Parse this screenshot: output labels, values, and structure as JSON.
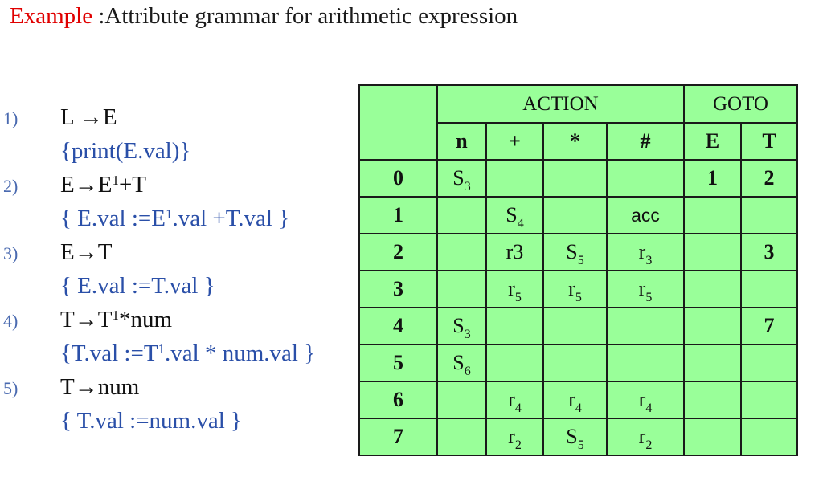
{
  "title": {
    "keyword": "Example",
    "text": " :Attribute grammar for arithmetic expression"
  },
  "rules": [
    {
      "num": "1)",
      "prod_a": "L →E",
      "prod_sup": "",
      "prod_b": "",
      "action_a": "{print(E.val)}",
      "action_sup": "",
      "action_b": ""
    },
    {
      "num": "2)",
      "prod_a": "E→E",
      "prod_sup": "1",
      "prod_b": "+T",
      "action_a": "{ E.val :=E",
      "action_sup": "1",
      "action_b": ".val +T.val }"
    },
    {
      "num": "3)",
      "prod_a": "E→T",
      "prod_sup": "",
      "prod_b": "",
      "action_a": "{ E.val :=T.val }",
      "action_sup": "",
      "action_b": ""
    },
    {
      "num": "4)",
      "prod_a": "T→T",
      "prod_sup": "1",
      "prod_b": "*num",
      "action_a": "{T.val :=T",
      "action_sup": "1",
      "action_b": ".val * num.val }"
    },
    {
      "num": "5)",
      "prod_a": "T→num",
      "prod_sup": "",
      "prod_b": "",
      "action_a": "{  T.val :=num.val }",
      "action_sup": "",
      "action_b": ""
    }
  ],
  "table": {
    "group_action": "ACTION",
    "group_goto": "GOTO",
    "columns": [
      "n",
      "+",
      "*",
      "#",
      "E",
      "T"
    ],
    "rows": [
      {
        "state": "0",
        "cells": [
          [
            "S",
            "3"
          ],
          [
            "",
            ""
          ],
          [
            "",
            ""
          ],
          [
            "",
            ""
          ],
          [
            "1",
            ""
          ],
          [
            "2",
            ""
          ]
        ]
      },
      {
        "state": "1",
        "cells": [
          [
            "",
            ""
          ],
          [
            "S",
            "4"
          ],
          [
            "",
            ""
          ],
          [
            "acc",
            ""
          ],
          [
            "",
            ""
          ],
          [
            "",
            ""
          ]
        ]
      },
      {
        "state": "2",
        "cells": [
          [
            "",
            ""
          ],
          [
            "r3",
            ""
          ],
          [
            "S",
            "5"
          ],
          [
            "r",
            "3"
          ],
          [
            "",
            ""
          ],
          [
            "3",
            ""
          ]
        ]
      },
      {
        "state": "3",
        "cells": [
          [
            "",
            ""
          ],
          [
            "r",
            "5"
          ],
          [
            "r",
            "5"
          ],
          [
            "r",
            "5"
          ],
          [
            "",
            ""
          ],
          [
            "",
            ""
          ]
        ]
      },
      {
        "state": "4",
        "cells": [
          [
            "S",
            "3"
          ],
          [
            "",
            ""
          ],
          [
            "",
            ""
          ],
          [
            "",
            ""
          ],
          [
            "",
            ""
          ],
          [
            "7",
            ""
          ]
        ]
      },
      {
        "state": "5",
        "cells": [
          [
            "S",
            "6"
          ],
          [
            "",
            ""
          ],
          [
            "",
            ""
          ],
          [
            "",
            ""
          ],
          [
            "",
            ""
          ],
          [
            "",
            ""
          ]
        ]
      },
      {
        "state": "6",
        "cells": [
          [
            "",
            ""
          ],
          [
            "r",
            "4"
          ],
          [
            "r",
            "4"
          ],
          [
            "r",
            "4"
          ],
          [
            "",
            ""
          ],
          [
            "",
            ""
          ]
        ]
      },
      {
        "state": "7",
        "cells": [
          [
            "",
            ""
          ],
          [
            "r",
            "2"
          ],
          [
            "S",
            "5"
          ],
          [
            "r",
            "2"
          ],
          [
            "",
            ""
          ],
          [
            "",
            ""
          ]
        ]
      }
    ]
  }
}
